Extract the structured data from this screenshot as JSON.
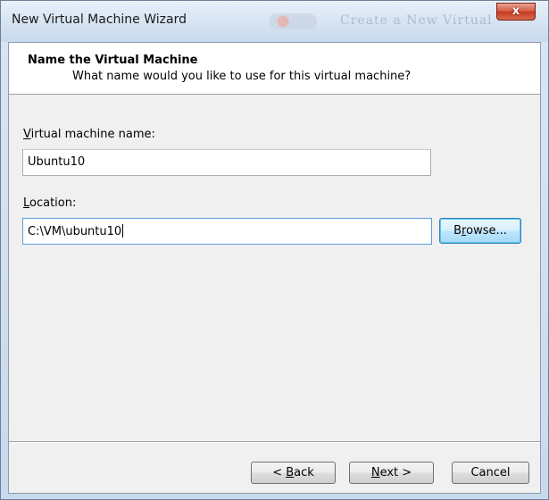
{
  "window": {
    "title": "New Virtual Machine Wizard",
    "background_title": "Create a New Virtual",
    "close_glyph": "x"
  },
  "header": {
    "title": "Name the Virtual Machine",
    "subtitle": "What name would you like to use for this virtual machine?"
  },
  "form": {
    "vm_name_label_hotkey": "V",
    "vm_name_label_rest": "irtual machine name:",
    "vm_name_value": "Ubuntu10",
    "location_label_hotkey": "L",
    "location_label_rest": "ocation:",
    "location_value": "C:\\VM\\ubuntu10",
    "browse_hotkey": "r",
    "browse_pre": "B",
    "browse_post": "owse..."
  },
  "footer": {
    "back_pre": "< ",
    "back_hotkey": "B",
    "back_post": "ack",
    "next_hotkey": "N",
    "next_post": "ext >",
    "cancel_label": "Cancel"
  },
  "colors": {
    "accent_default_button": "#3c7fb1",
    "focused_input_border": "#5d9ae0",
    "close_button": "#c3381f"
  }
}
